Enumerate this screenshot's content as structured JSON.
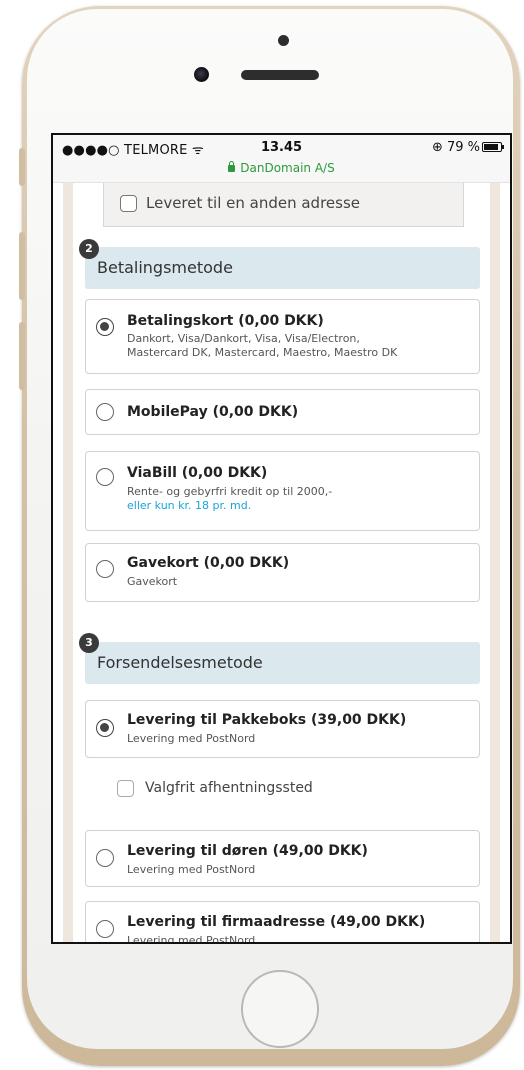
{
  "status_bar": {
    "carrier": "●●●●○ TELMORE ᯤ",
    "time": "13.45",
    "battery": "⊕ 79 %",
    "domain": "DanDomain A/S"
  },
  "shipping_address": {
    "checkbox_label": "Leveret til en anden adresse"
  },
  "payment_section": {
    "number": "2",
    "title": "Betalingsmetode",
    "options": [
      {
        "title": "Betalingskort (0,00 DKK)",
        "desc_line1": "Dankort, Visa/Dankort, Visa, Visa/Electron,",
        "desc_line2": "Mastercard DK, Mastercard, Maestro, Maestro DK",
        "selected": true
      },
      {
        "title": "MobilePay (0,00 DKK)",
        "selected": false
      },
      {
        "title": "ViaBill (0,00 DKK)",
        "desc_line1": "Rente- og gebyrfri kredit op til 2000,-",
        "link": "eller kun kr. 18 pr. md.",
        "selected": false
      },
      {
        "title": "Gavekort (0,00 DKK)",
        "desc_line1": "Gavekort",
        "selected": false
      }
    ]
  },
  "shipping_section": {
    "number": "3",
    "title": "Forsendelsesmetode",
    "options": [
      {
        "title": "Levering til Pakkeboks (39,00 DKK)",
        "desc_line1": "Levering med PostNord",
        "selected": true
      },
      {
        "title": "Levering til døren (49,00 DKK)",
        "desc_line1": "Levering med PostNord",
        "selected": false
      },
      {
        "title": "Levering til firmaadresse (49,00 DKK)",
        "desc_line1": "Levering med PostNord",
        "selected": false
      }
    ],
    "pickup_checkbox_label": "Valgfrit afhentningssted"
  },
  "colors": {
    "section_header_bg": "#dbe8ee",
    "link": "#1aa3d9",
    "secure_green": "#2e9b3a",
    "rail": "#efe6dd"
  }
}
